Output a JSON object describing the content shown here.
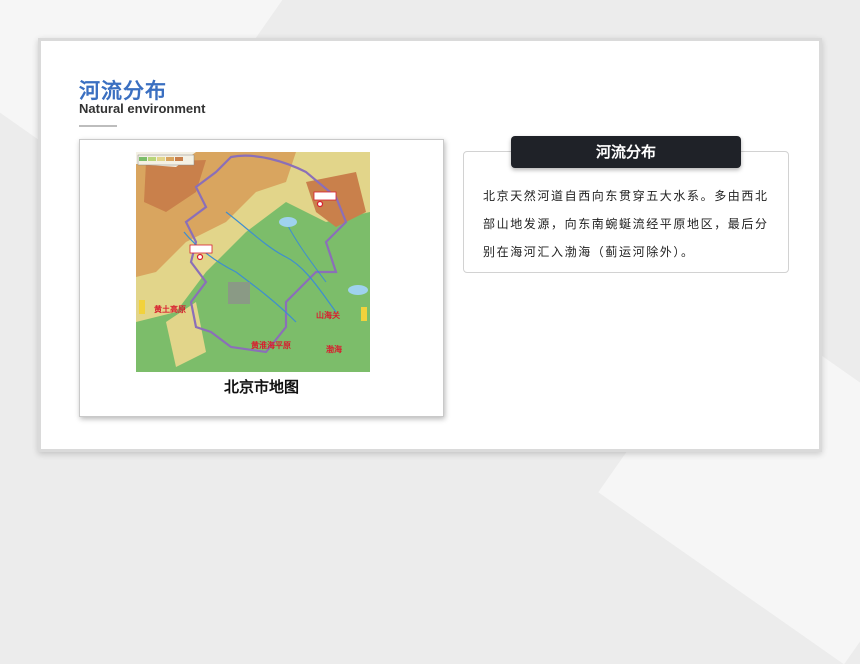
{
  "slide": {
    "title_cn": "河流分布",
    "title_en": "Natural environment"
  },
  "map": {
    "caption": "北京市地图",
    "labels": {
      "loess_plateau": "黄土高原",
      "huanghuai_plain": "黄淮海平原",
      "shanhai_pass": "山海关",
      "bohai_sea": "渤海"
    },
    "colors": {
      "plain": "#7cbd6a",
      "hill": "#e2d58a",
      "mountain": "#c9804b",
      "border": "#8b6fb8",
      "label_red": "#d81e2f"
    }
  },
  "info": {
    "tag": "河流分布",
    "text": "北京天然河道自西向东贯穿五大水系。多由西北部山地发源，向东南蜿蜒流经平原地区，最后分别在海河汇入渤海（蓟运河除外）。"
  }
}
